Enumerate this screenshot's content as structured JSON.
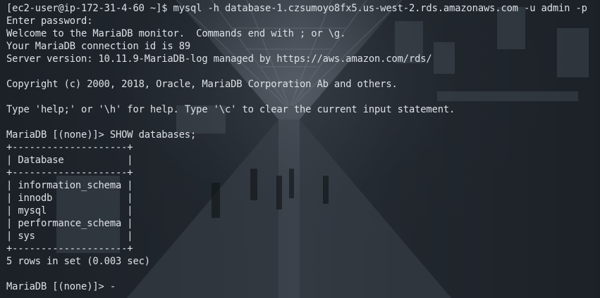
{
  "terminal": {
    "lines": [
      "[ec2-user@ip-172-31-4-60 ~]$ mysql -h database-1.czsumoyo8fx5.us-west-2.rds.amazonaws.com -u admin -p",
      "Enter password:",
      "Welcome to the MariaDB monitor.  Commands end with ; or \\g.",
      "Your MariaDB connection id is 89",
      "Server version: 10.11.9-MariaDB-log managed by https://aws.amazon.com/rds/",
      "",
      "Copyright (c) 2000, 2018, Oracle, MariaDB Corporation Ab and others.",
      "",
      "Type 'help;' or '\\h' for help. Type '\\c' to clear the current input statement.",
      "",
      "MariaDB [(none)]> SHOW databases;",
      "+--------------------+",
      "| Database           |",
      "+--------------------+",
      "| information_schema |",
      "| innodb             |",
      "| mysql              |",
      "| performance_schema |",
      "| sys                |",
      "+--------------------+",
      "5 rows in set (0.003 sec)",
      "",
      "MariaDB [(none)]> -"
    ]
  },
  "colors": {
    "text": "#dde1e6",
    "background": "#20252c"
  }
}
